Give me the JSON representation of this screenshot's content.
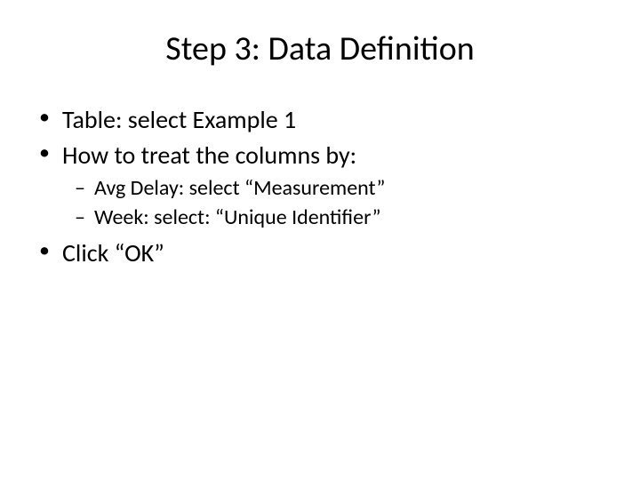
{
  "title": "Step 3: Data Definition",
  "bullets": {
    "b1": "Table: select Example 1",
    "b2": "How to treat the columns by:",
    "b2_sub": {
      "s1": "Avg Delay: select “Measurement”",
      "s2": "Week: select: “Unique Identifier”"
    },
    "b3": "Click “OK”"
  }
}
